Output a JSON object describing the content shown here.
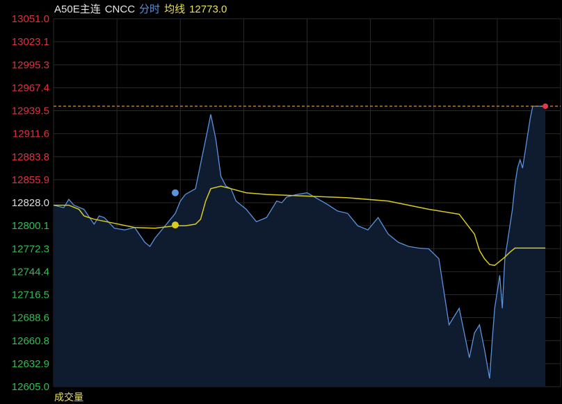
{
  "header": {
    "instrument": "A50E主连",
    "exchange": "CNCC",
    "mode": "分时",
    "avg_label": "均线",
    "avg_value": "12773.0"
  },
  "footer": {
    "label": "成交量"
  },
  "colors": {
    "background": "#000000",
    "grid": "#2a2a2a",
    "price_line": "#5a93de",
    "area_fill": "#0f1c2f",
    "avg_line": "#d9cc1e",
    "up_text": "#e0323c",
    "down_text": "#2fbf4f",
    "ref_text": "#dddddd",
    "last_price_marker": "#e03a48",
    "dash_line": "#e6922d",
    "text_white": "#e6e6e6",
    "text_blue": "#5a93de",
    "text_yellow": "#e8e05a"
  },
  "chart_data": {
    "type": "line",
    "ylim": [
      12605.0,
      13051.0
    ],
    "reference_price": 12828.0,
    "last_price": 12945.0,
    "y_ticks": [
      "13051.0",
      "13023.1",
      "12995.3",
      "12967.4",
      "12939.5",
      "12911.6",
      "12883.8",
      "12855.9",
      "12828.0",
      "12800.1",
      "12772.3",
      "12744.4",
      "12716.5",
      "12688.6",
      "12660.8",
      "12632.9",
      "12605.0"
    ],
    "x_range": [
      0,
      100
    ],
    "series": [
      {
        "key": "price",
        "x": [
          0,
          2,
          3,
          4,
          6,
          8,
          9,
          10,
          12,
          14,
          16,
          18,
          19,
          20,
          22,
          24,
          25,
          26,
          28,
          30,
          31,
          32,
          33,
          34,
          35,
          36,
          38,
          40,
          42,
          44,
          45,
          46,
          48,
          50,
          52,
          54,
          56,
          58,
          60,
          62,
          64,
          66,
          68,
          70,
          72,
          74,
          76,
          78,
          80,
          82,
          83,
          84,
          85,
          86,
          86.5,
          87,
          87.5,
          88,
          88.5,
          89,
          89.5,
          90,
          90.5,
          91,
          91.5,
          92,
          92.5,
          93,
          93.5,
          94,
          94.5,
          95,
          95.5,
          96,
          96.5,
          97
        ],
        "values": [
          12825,
          12822,
          12832,
          12825,
          12820,
          12802,
          12812,
          12810,
          12797,
          12795,
          12798,
          12780,
          12775,
          12785,
          12800,
          12815,
          12830,
          12838,
          12845,
          12905,
          12935,
          12905,
          12860,
          12848,
          12845,
          12830,
          12820,
          12805,
          12810,
          12830,
          12828,
          12835,
          12838,
          12840,
          12833,
          12826,
          12818,
          12815,
          12800,
          12795,
          12810,
          12790,
          12780,
          12775,
          12773,
          12772,
          12760,
          12680,
          12700,
          12640,
          12670,
          12680,
          12650,
          12615,
          12660,
          12700,
          12720,
          12740,
          12700,
          12760,
          12780,
          12800,
          12820,
          12850,
          12870,
          12880,
          12870,
          12890,
          12910,
          12930,
          12945,
          12945,
          12945,
          12945,
          12945,
          12945
        ]
      },
      {
        "key": "avg",
        "x": [
          0,
          3,
          5,
          6,
          8,
          12,
          16,
          20,
          24,
          26,
          28,
          29,
          30,
          31,
          33,
          35,
          38,
          42,
          50,
          58,
          66,
          74,
          80,
          82,
          83,
          84,
          85,
          86,
          87,
          88,
          89,
          90,
          91,
          92,
          93,
          94,
          95,
          96,
          97
        ],
        "values": [
          12825,
          12825,
          12820,
          12812,
          12808,
          12803,
          12798,
          12797,
          12800,
          12800,
          12802,
          12808,
          12830,
          12845,
          12848,
          12845,
          12840,
          12838,
          12836,
          12834,
          12830,
          12820,
          12814,
          12798,
          12790,
          12770,
          12760,
          12753,
          12752,
          12757,
          12762,
          12768,
          12773,
          12773,
          12773,
          12773,
          12773,
          12773,
          12773
        ]
      }
    ],
    "markers": [
      {
        "series": "avg",
        "x": 24,
        "value": 12801
      },
      {
        "series": "price",
        "x": 24,
        "value": 12840
      }
    ]
  }
}
